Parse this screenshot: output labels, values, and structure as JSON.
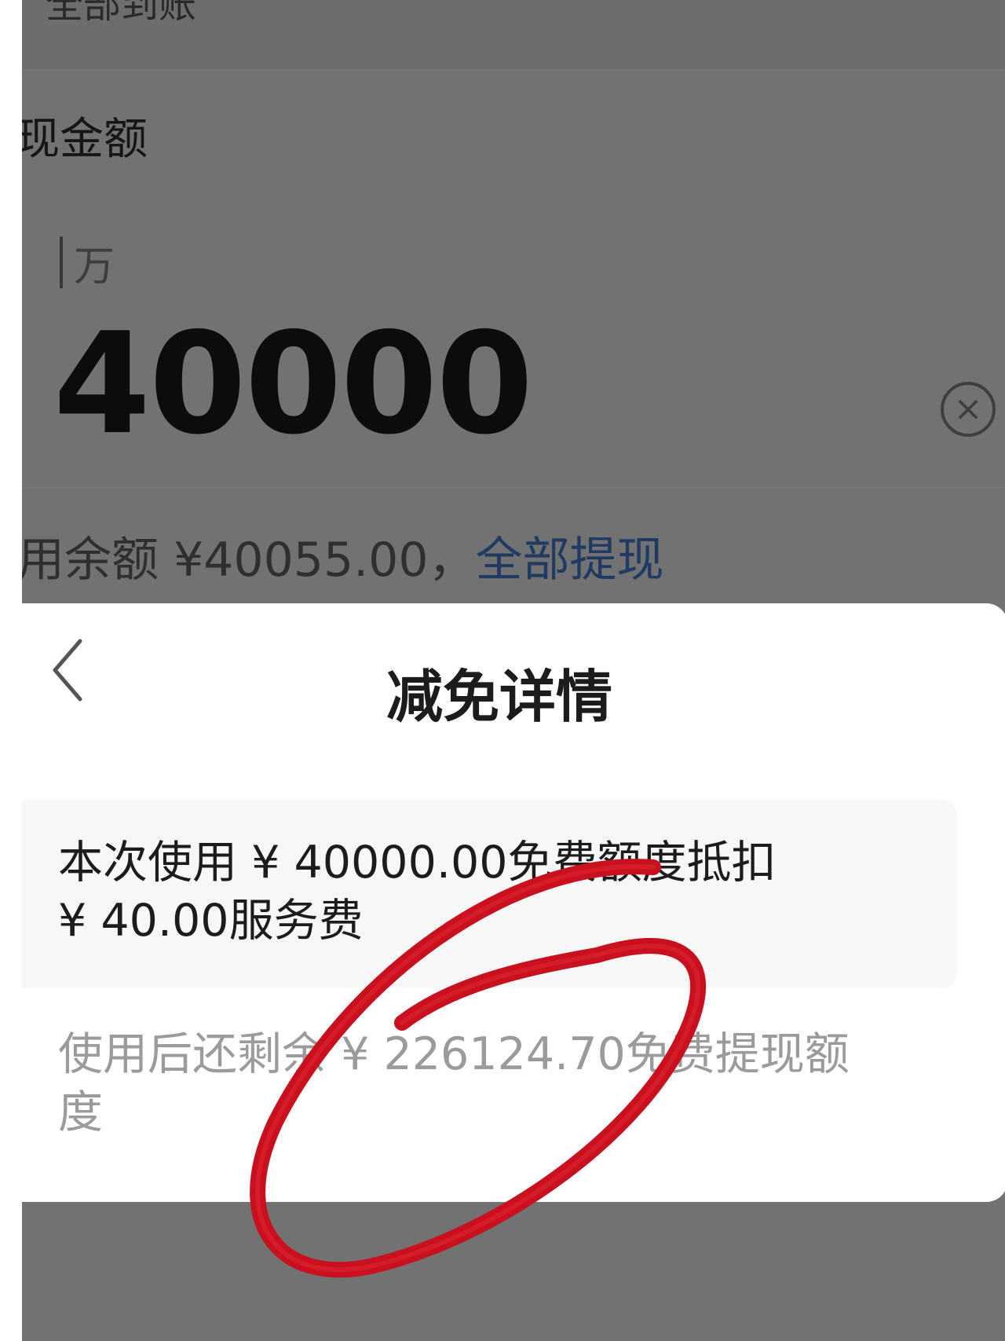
{
  "background_page": {
    "top_row_text": "全部到账",
    "section_label": "现金额",
    "unit_hint": "万",
    "amount_value": "40000",
    "clear_icon": "clear-circle-x-icon",
    "balance_text": "用余额 ¥40055.00，",
    "withdraw_all_label": "全部提现"
  },
  "sheet": {
    "back_icon": "chevron-left-icon",
    "title": "减免详情",
    "deduction_line_1": "本次使用 ¥ 40000.00免费额度抵扣",
    "deduction_line_2": "¥ 40.00服务费",
    "remaining_line_1": "使用后还剩余 ¥ 226124.70免费提现额",
    "remaining_line_2": "度"
  },
  "colors": {
    "overlay": "#727272",
    "link": "#1f3a63",
    "annotation_red": "#c8101e",
    "sheet_bg": "#ffffff",
    "card_bg": "#f7f7f7"
  }
}
